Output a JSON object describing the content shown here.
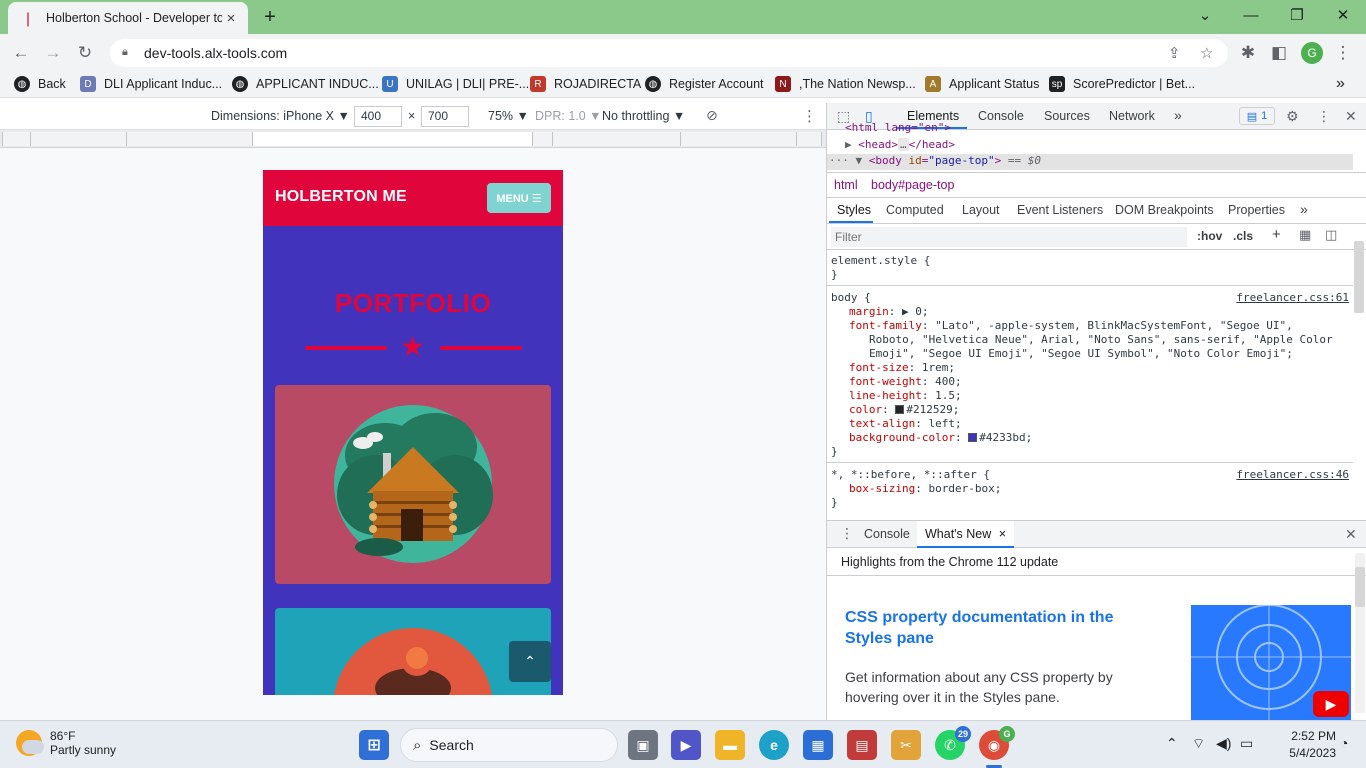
{
  "browser": {
    "tab_title": "Holberton School - Developer to",
    "url": "dev-tools.alx-tools.com",
    "profile_initial": "G",
    "bookmarks": [
      {
        "label": "Back",
        "icon": "globe-icon"
      },
      {
        "label": "DLI Applicant Induc...",
        "icon": "dli-icon"
      },
      {
        "label": "APPLICANT INDUC...",
        "icon": "globe-icon"
      },
      {
        "label": "UNILAG | DLI| PRE-...",
        "icon": "unilag-icon"
      },
      {
        "label": "ROJADIRECTA",
        "icon": "rojadirecta-icon"
      },
      {
        "label": "Register Account",
        "icon": "globe-icon"
      },
      {
        "label": ",The Nation Newsp...",
        "icon": "nation-icon"
      },
      {
        "label": "Applicant Status",
        "icon": "applicant-icon"
      },
      {
        "label": "ScorePredictor | Bet...",
        "icon": "sp-icon"
      }
    ]
  },
  "device_toolbar": {
    "dimensions_label": "Dimensions: iPhone X ▼",
    "width_value": "400",
    "times": "×",
    "height_value": "700",
    "zoom": "75% ▼",
    "dpr": "DPR: 1.0 ▼",
    "throttling": "No throttling ▼"
  },
  "phone_page": {
    "brand": "HOLBERTON ME",
    "menu_label": "MENU ☰",
    "heading": "PORTFOLIO",
    "colors": {
      "nav": "#e0063b",
      "body": "#4233bd",
      "card1": "#b94a66",
      "card2": "#1fa3b8",
      "menu": "#7fd3d0"
    }
  },
  "devtools": {
    "tabs": [
      "Elements",
      "Console",
      "Sources",
      "Network"
    ],
    "more_tabs": "»",
    "issues_count": "1",
    "dom": {
      "line0": "<html lang=\"en\">",
      "head_open": "<head>",
      "head_ellipsis": "…",
      "head_close": "</head>",
      "body_prefix": "··· ▼",
      "body_tag_open": "<body",
      "body_attr": "id",
      "body_attr_val": "\"page-top\"",
      "body_tag_close": ">",
      "body_suffix": "== $0"
    },
    "breadcrumbs": [
      "html",
      "body#page-top"
    ],
    "subtabs": [
      "Styles",
      "Computed",
      "Layout",
      "Event Listeners",
      "DOM Breakpoints",
      "Properties"
    ],
    "subtabs_more": "»",
    "filter_placeholder": "Filter",
    "filter_tools": [
      ":hov",
      ".cls",
      "+"
    ],
    "styles": {
      "element_style_open": "element.style {",
      "brace_close": "}",
      "body_selector": "body {",
      "body_source": "freelancer.css:61",
      "margin_name": "margin",
      "margin_value": "▶ 0;",
      "font_family_name": "font-family",
      "font_family_value": "\"Lato\", -apple-system, BlinkMacSystemFont, \"Segoe UI\",",
      "font_family_cont1": "Roboto, \"Helvetica Neue\", Arial, \"Noto Sans\", sans-serif, \"Apple Color",
      "font_family_cont2": "Emoji\", \"Segoe UI Emoji\", \"Segoe UI Symbol\", \"Noto Color Emoji\";",
      "font_size_name": "font-size",
      "font_size_value": "1rem;",
      "font_weight_name": "font-weight",
      "font_weight_value": "400;",
      "line_height_name": "line-height",
      "line_height_value": "1.5;",
      "color_name": "color",
      "color_value": "#212529;",
      "color_swatch": "#212529",
      "text_align_name": "text-align",
      "text_align_value": "left;",
      "bg_name": "background-color",
      "bg_value": "#4233bd;",
      "bg_swatch": "#4233bd",
      "universal_selector": "*, *::before, *::after {",
      "universal_source": "freelancer.css:46",
      "box_sizing_name": "box-sizing",
      "box_sizing_value": "border-box;"
    },
    "drawer": {
      "tabs": [
        "Console",
        "What's New"
      ],
      "close_tab": "×",
      "highlights": "Highlights from the Chrome 112 update",
      "feature_title": "CSS property documentation in the Styles pane",
      "feature_body": "Get information about any CSS property by hovering over it in the Styles pane."
    }
  },
  "taskbar": {
    "temperature": "86°F",
    "weather": "Partly sunny",
    "search_label": "Search",
    "whatsapp_badge": "29",
    "chrome_badge": "G",
    "time": "2:52 PM",
    "date": "5/4/2023"
  }
}
